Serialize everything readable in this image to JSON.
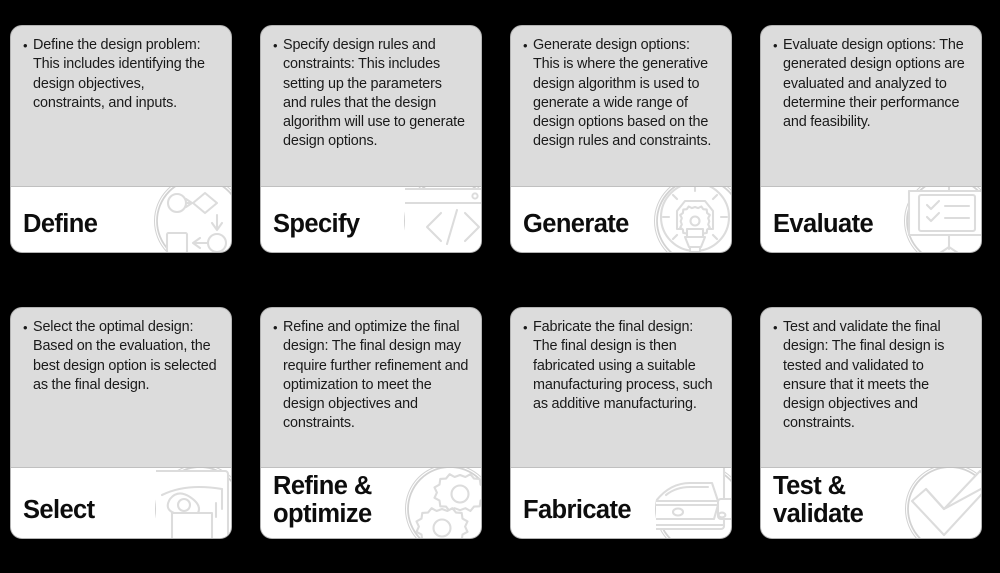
{
  "background_color": "#000000",
  "card_body_color": "#dcdcdc",
  "card_footer_color": "#ffffff",
  "card_border_color": "#b4b4b4",
  "icon_stroke_color": "#dcdcdc",
  "text_color": "#1a1a1a",
  "bullet_glyph": "•",
  "cards": [
    {
      "id": "define",
      "bullet": "Define the design problem: This includes identifying the design objectives, constraints, and inputs.",
      "title": "Define",
      "icon": "flow-diagram-icon"
    },
    {
      "id": "specify",
      "bullet": "Specify design rules and constraints: This includes setting up the parameters and rules that the design algorithm will use to generate design options.",
      "title": "Specify",
      "icon": "code-brackets-icon"
    },
    {
      "id": "generate",
      "bullet": "Generate design options: This is where the generative design algorithm is used to generate a wide range of design options based on the design rules and constraints.",
      "title": "Generate",
      "icon": "gear-dial-icon"
    },
    {
      "id": "evaluate",
      "bullet": "Evaluate design options: The generated design options are evaluated and analyzed to determine their performance and feasibility.",
      "title": "Evaluate",
      "icon": "presentation-checklist-icon"
    },
    {
      "id": "select",
      "bullet": "Select the optimal design: Based on the evaluation, the best design option is selected as the final design.",
      "title": "Select",
      "icon": "cursor-select-icon"
    },
    {
      "id": "refine-optimize",
      "bullet": "Refine and optimize the final design: The final design may require further refinement and optimization to meet the design objectives and constraints.",
      "title": "Refine &\noptimize",
      "icon": "gears-icon"
    },
    {
      "id": "fabricate",
      "bullet": "Fabricate the final design: The final design is then fabricated using a suitable manufacturing process, such as additive manufacturing.",
      "title": "Fabricate",
      "icon": "machine-fabrication-icon"
    },
    {
      "id": "test-validate",
      "bullet": "Test and validate the final design: The final design is tested and validated to ensure that it meets the design objectives and constraints.",
      "title": "Test &\nvalidate",
      "icon": "checkmark-icon"
    }
  ]
}
